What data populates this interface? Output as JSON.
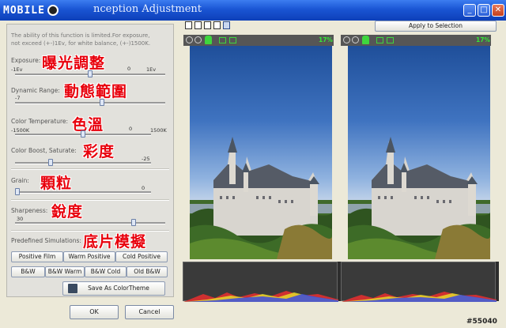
{
  "titlebar": {
    "logo_text": "MOBILE",
    "title": "nception Adjustment",
    "minimize": "_",
    "maximize": "□",
    "close": "✕"
  },
  "intro_text": [
    "The ability of this function is limited.For exposure,",
    "not exceed (+-)1Ev, for white balance, (+-)1500K."
  ],
  "exposure": {
    "label": "Exposure:",
    "annotation": "曝光調整",
    "min": "-1Ev",
    "max": "1Ev",
    "value": "0",
    "fraction": 0.5
  },
  "dynamic_range": {
    "label": "Dynamic Range:",
    "annotation": "動態範圍",
    "value": "-7",
    "fraction": 0.58
  },
  "color_temp": {
    "label": "Color Temperature:",
    "annotation": "色溫",
    "min": "-1500K",
    "max": "1500K",
    "value": "0",
    "fraction": 0.5
  },
  "color_boost": {
    "label": "Color Boost, Saturate:",
    "annotation": "彩度",
    "value": "-25",
    "fraction": 0.25
  },
  "grain": {
    "label": "Grain:",
    "annotation": "顆粒",
    "value": "0",
    "fraction": 0.0
  },
  "sharpness": {
    "label": "Sharpeness:",
    "annotation": "銳度",
    "value": "30",
    "fraction": 0.8
  },
  "simulations": {
    "label": "Predefined Simulations:",
    "annotation": "底片模擬",
    "row1": [
      "Positive Film",
      "Warm Positive",
      "Cold Positive"
    ],
    "row2": [
      "B&W",
      "B&W Warm",
      "B&W Cold",
      "Old B&W"
    ],
    "save_theme": "Save As ColorTheme"
  },
  "footer": {
    "ok": "OK",
    "cancel": "Cancel"
  },
  "preview": {
    "apply": "Apply to Selection",
    "zoom_left": "17%",
    "zoom_right": "17%"
  },
  "watermark": "#55040",
  "colors": {
    "accent": "#1a55d4",
    "annotation": "#e8000c",
    "zoom_text": "#35e835"
  }
}
